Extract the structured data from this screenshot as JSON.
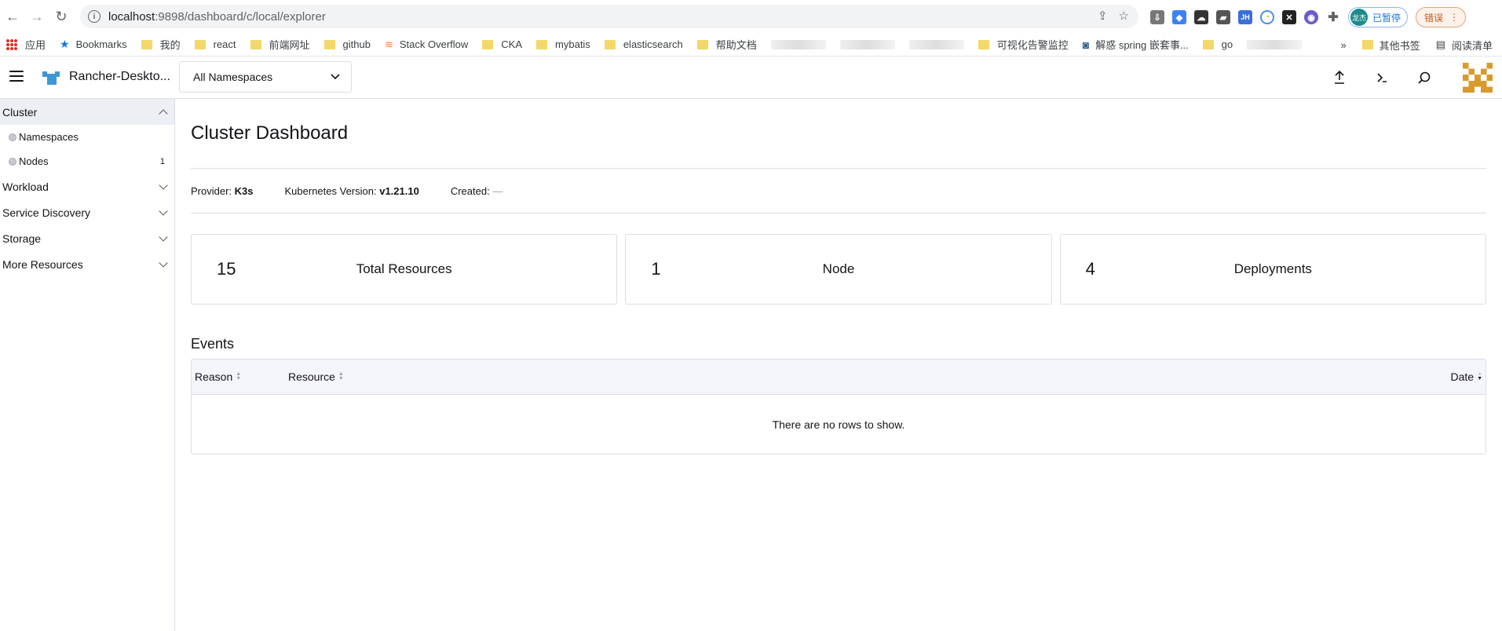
{
  "browser": {
    "url_host": "localhost",
    "url_path": ":9898/dashboard/c/local/explorer",
    "profile_label": "已暂停",
    "profile_avatar": "龙杰",
    "error_label": "错误"
  },
  "bookmarks": {
    "items": [
      {
        "label": "应用",
        "kind": "apps"
      },
      {
        "label": "Bookmarks",
        "kind": "star"
      },
      {
        "label": "我的",
        "kind": "folder"
      },
      {
        "label": "react",
        "kind": "folder"
      },
      {
        "label": "前端网址",
        "kind": "folder"
      },
      {
        "label": "github",
        "kind": "folder"
      },
      {
        "label": "Stack Overflow",
        "kind": "so"
      },
      {
        "label": "CKA",
        "kind": "folder"
      },
      {
        "label": "mybatis",
        "kind": "folder"
      },
      {
        "label": "elasticsearch",
        "kind": "folder"
      },
      {
        "label": "帮助文档",
        "kind": "folder"
      },
      {
        "label": "",
        "kind": "blur"
      },
      {
        "label": "",
        "kind": "blur"
      },
      {
        "label": "",
        "kind": "blur"
      },
      {
        "label": "可视化告警监控",
        "kind": "folder"
      },
      {
        "label": "解惑 spring 嵌套事...",
        "kind": "page"
      },
      {
        "label": "go",
        "kind": "folder"
      },
      {
        "label": "",
        "kind": "blur"
      }
    ],
    "overflow": "»",
    "other_label": "其他书签",
    "reading_label": "阅读清单"
  },
  "header": {
    "cluster_name": "Rancher-Deskto...",
    "namespace_selected": "All Namespaces"
  },
  "sidebar": {
    "groups": [
      {
        "label": "Cluster",
        "expanded": true,
        "children": [
          {
            "label": "Namespaces",
            "count": ""
          },
          {
            "label": "Nodes",
            "count": "1"
          }
        ]
      },
      {
        "label": "Workload",
        "expanded": false
      },
      {
        "label": "Service Discovery",
        "expanded": false
      },
      {
        "label": "Storage",
        "expanded": false
      },
      {
        "label": "More Resources",
        "expanded": false
      }
    ]
  },
  "main": {
    "title": "Cluster Dashboard",
    "provider_label": "Provider:",
    "provider_value": "K3s",
    "k8s_label": "Kubernetes Version:",
    "k8s_value": "v1.21.10",
    "created_label": "Created:",
    "created_value": "—",
    "cards": [
      {
        "count": "15",
        "label": "Total Resources"
      },
      {
        "count": "1",
        "label": "Node"
      },
      {
        "count": "4",
        "label": "Deployments"
      }
    ],
    "events_title": "Events",
    "table": {
      "columns": [
        "Reason",
        "Resource",
        "Date"
      ],
      "empty_text": "There are no rows to show."
    }
  },
  "colors": {
    "rancher_blue": "#3d98d3",
    "avatar_gold": "#d99a2b",
    "border": "#dcdee7"
  }
}
